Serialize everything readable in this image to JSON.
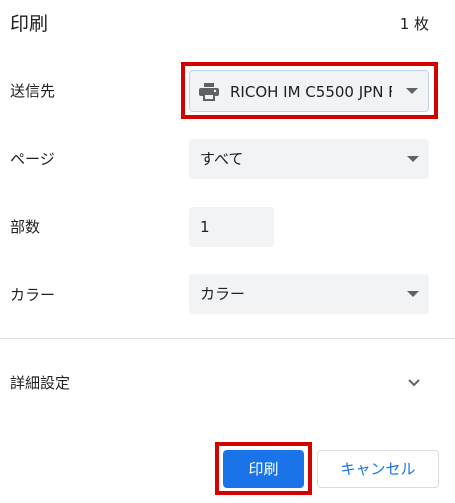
{
  "header": {
    "title": "印刷",
    "sheet_count": "1 枚"
  },
  "destination": {
    "label": "送信先",
    "value": "RICOH IM C5500 JPN F",
    "icon": "printer-icon"
  },
  "pages": {
    "label": "ページ",
    "value": "すべて"
  },
  "copies": {
    "label": "部数",
    "value": "1"
  },
  "color": {
    "label": "カラー",
    "value": "カラー"
  },
  "more_settings": {
    "label": "詳細設定",
    "icon": "chevron-down-icon"
  },
  "actions": {
    "print_label": "印刷",
    "cancel_label": "キャンセル"
  },
  "colors": {
    "accent": "#1a73e8",
    "highlight": "#d50000",
    "field_bg": "#f1f3f4"
  }
}
